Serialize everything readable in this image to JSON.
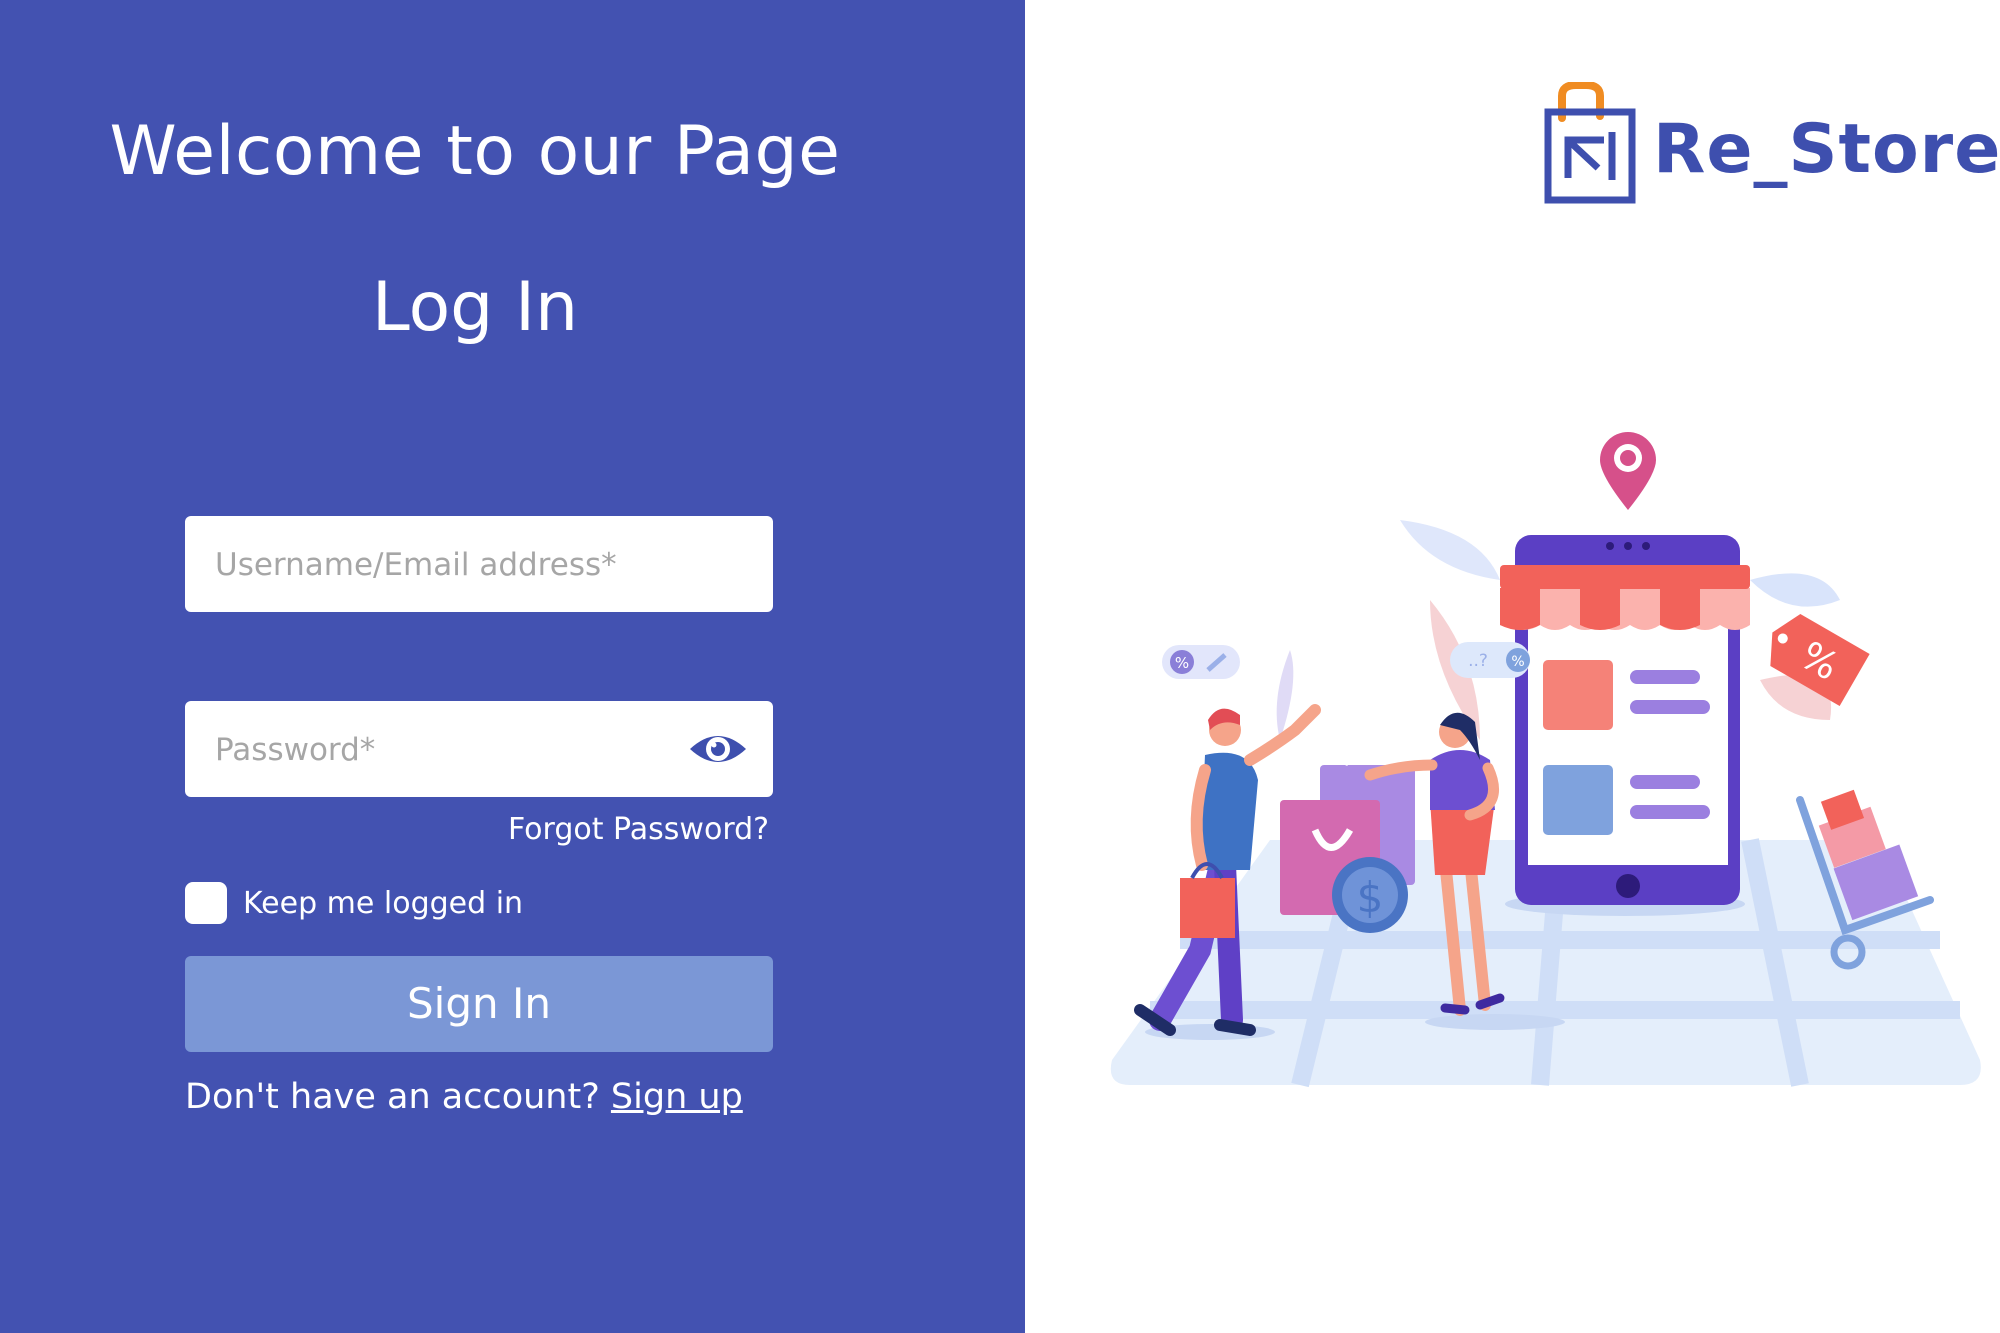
{
  "colors": {
    "panel_bg": "#4352b1",
    "button_bg": "#7b97d6",
    "logo_blue": "#3e4fae",
    "logo_orange": "#f08c22"
  },
  "left": {
    "welcome": "Welcome to our Page",
    "title": "Log In",
    "username_placeholder": "Username/Email address*",
    "password_placeholder": "Password*",
    "forgot": "Forgot Password?",
    "keep_logged_in": "Keep me logged in",
    "sign_in": "Sign In",
    "no_account": "Don't have an account? ",
    "sign_up": "Sign up"
  },
  "logo": {
    "text": "Re_Store",
    "icon": "shopping-bag-icon"
  },
  "illustration": {
    "icons": [
      "location-pin-icon",
      "eye-icon",
      "price-tag-icon",
      "dollar-coin-icon"
    ],
    "tag_text": "%",
    "bubble_left": "%",
    "bubble_right": "..?",
    "coin_symbol": "$"
  }
}
